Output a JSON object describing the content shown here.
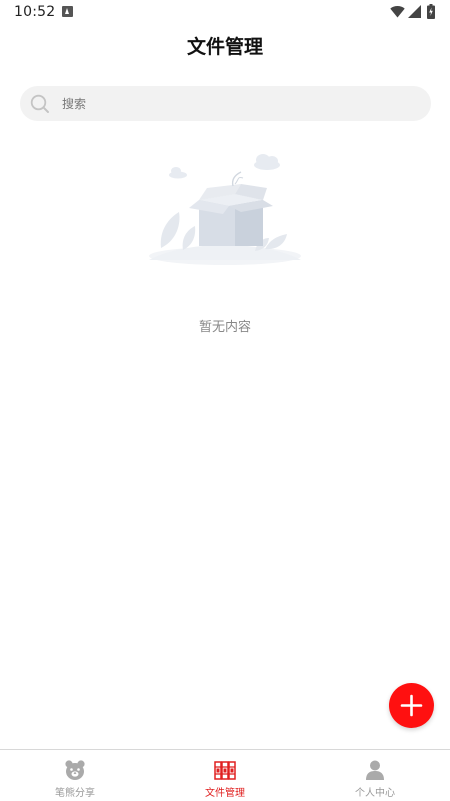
{
  "status_bar": {
    "time": "10:52",
    "icons": [
      "notification-icon",
      "wifi-icon",
      "signal-icon",
      "battery-charging-icon"
    ]
  },
  "header": {
    "title": "文件管理"
  },
  "search": {
    "placeholder": "搜索",
    "value": "",
    "icon": "search-icon"
  },
  "empty_state": {
    "illustration": "empty-box-illustration",
    "text": "暂无内容"
  },
  "fab": {
    "icon": "plus-icon",
    "color": "#ff1010"
  },
  "bottom_nav": {
    "active_color": "#e02020",
    "inactive_color": "#999999",
    "items": [
      {
        "label": "笔熊分享",
        "icon": "bear-icon",
        "active": false
      },
      {
        "label": "文件管理",
        "icon": "books-icon",
        "active": true
      },
      {
        "label": "个人中心",
        "icon": "person-icon",
        "active": false
      }
    ]
  }
}
